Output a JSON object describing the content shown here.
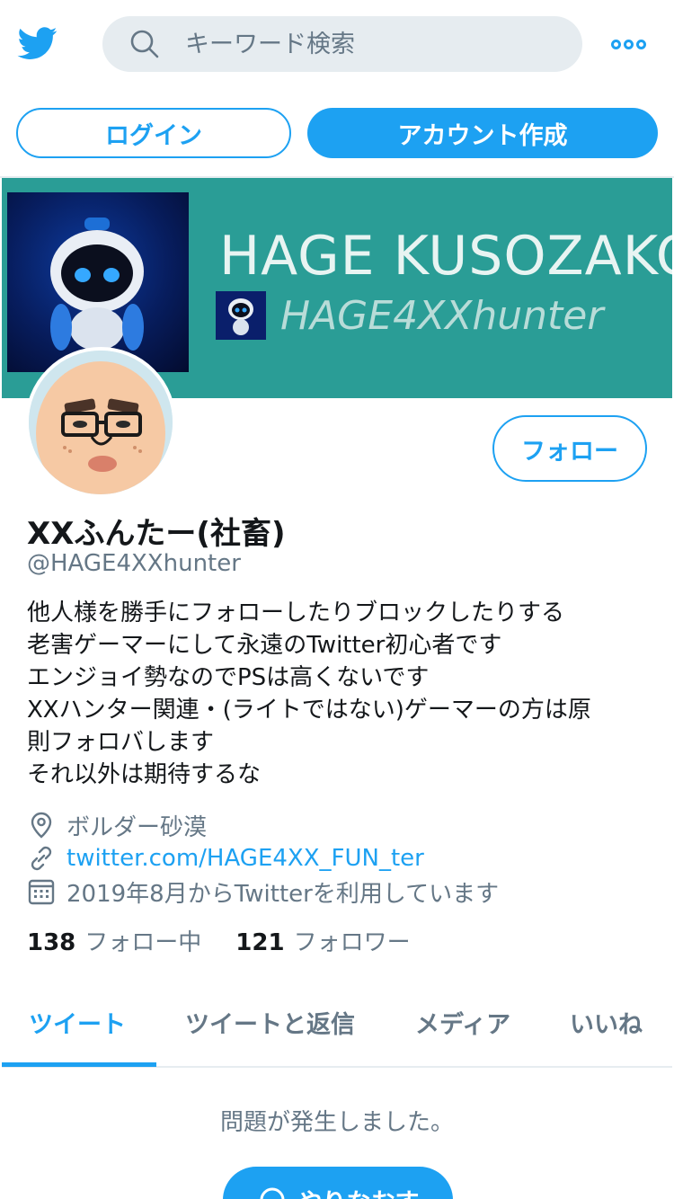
{
  "header": {
    "logo_icon": "twitter-bird-icon",
    "search_icon": "search-icon",
    "search_placeholder": "キーワード検索",
    "more_icon": "more-dots-icon",
    "login_label": "ログイン",
    "signup_label": "アカウント作成",
    "accent_color": "#1da1f2"
  },
  "banner": {
    "title": "HAGE KUSOZAKO",
    "handle": "HAGE4XXhunter",
    "background_color": "#2a9d96"
  },
  "profile": {
    "follow_label": "フォロー",
    "display_name": "XXふんたー(社畜)",
    "handle": "@HAGE4XXhunter",
    "bio_lines": [
      "他人様を勝手にフォローしたりブロックしたりする",
      "老害ゲーマーにして永遠のTwitter初心者です",
      "エンジョイ勢なのでPSは高くないです",
      "XXハンター関連・(ライトではない)ゲーマーの方は原",
      "則フォロバします",
      "それ以外は期待するな"
    ],
    "location": "ボルダー砂漠",
    "url": "twitter.com/HAGE4XX_FUN_ter",
    "joined": "2019年8月からTwitterを利用しています",
    "following_count": "138",
    "following_label": "フォロー中",
    "followers_count": "121",
    "followers_label": "フォロワー"
  },
  "tabs": [
    {
      "label": "ツイート",
      "active": true
    },
    {
      "label": "ツイートと返信",
      "active": false
    },
    {
      "label": "メディア",
      "active": false
    },
    {
      "label": "いいね",
      "active": false
    }
  ],
  "feed": {
    "error_message": "問題が発生しました。",
    "retry_label": "やりなおす"
  }
}
